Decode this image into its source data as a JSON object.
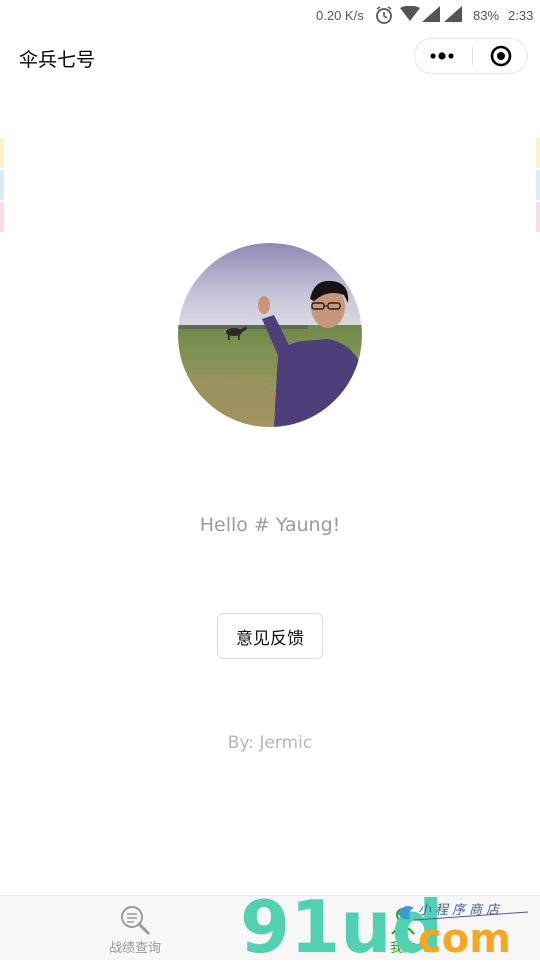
{
  "status_bar": {
    "network_speed": "0.20 K/s",
    "battery": "83%",
    "time": "2:33",
    "icons": [
      "alarm-icon",
      "wifi-icon",
      "signal-icon",
      "signal-icon"
    ]
  },
  "nav": {
    "title": "伞兵七号",
    "menu_icon": "more-dots-icon",
    "close_icon": "target-circle-icon"
  },
  "profile": {
    "greeting": "Hello # Yaung!",
    "feedback_button": "意见反馈",
    "author": "By: Jermic"
  },
  "tabs": [
    {
      "label": "战绩查询",
      "icon": "search-magnifier-icon",
      "active": false
    },
    {
      "label": "我的",
      "icon": "user-icon",
      "active": true
    }
  ],
  "watermark": {
    "brand": "91ud",
    "suffix": "com",
    "tagline": "小程序商店"
  },
  "colors": {
    "active_tab": "#1aad19",
    "inactive_tab": "#9a9a9a",
    "greeting_text": "#9b9b9b",
    "author_text": "#b5b5b5",
    "watermark_green": "#52d1b0",
    "watermark_orange": "#f5a623"
  }
}
